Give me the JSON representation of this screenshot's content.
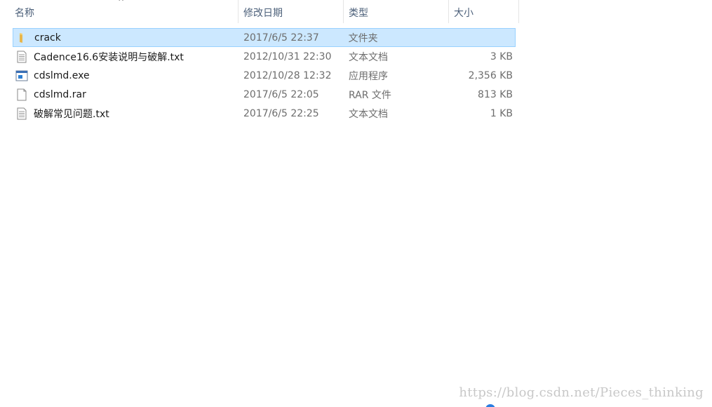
{
  "columns": {
    "name": "名称",
    "date": "修改日期",
    "type": "类型",
    "size": "大小",
    "sort_indicator": "^"
  },
  "files": [
    {
      "name": "crack",
      "date": "2017/6/5 22:37",
      "type": "文件夹",
      "size": "",
      "icon": "folder-icon",
      "selected": true
    },
    {
      "name": "Cadence16.6安装说明与破解.txt",
      "date": "2012/10/31 22:30",
      "type": "文本文档",
      "size": "3 KB",
      "icon": "text-file-icon",
      "selected": false
    },
    {
      "name": "cdslmd.exe",
      "date": "2012/10/28 12:32",
      "type": "应用程序",
      "size": "2,356 KB",
      "icon": "exe-file-icon",
      "selected": false
    },
    {
      "name": "cdslmd.rar",
      "date": "2017/6/5 22:05",
      "type": "RAR 文件",
      "size": "813 KB",
      "icon": "rar-file-icon",
      "selected": false
    },
    {
      "name": "破解常见问题.txt",
      "date": "2017/6/5 22:25",
      "type": "文本文档",
      "size": "1 KB",
      "icon": "text-file-icon",
      "selected": false
    }
  ],
  "watermark": "https://blog.csdn.net/Pieces_thinking",
  "colors": {
    "selection_bg": "#cce8ff",
    "selection_border": "#99d1ff",
    "header_text": "#4c607a",
    "folder": "#e8b64c"
  }
}
